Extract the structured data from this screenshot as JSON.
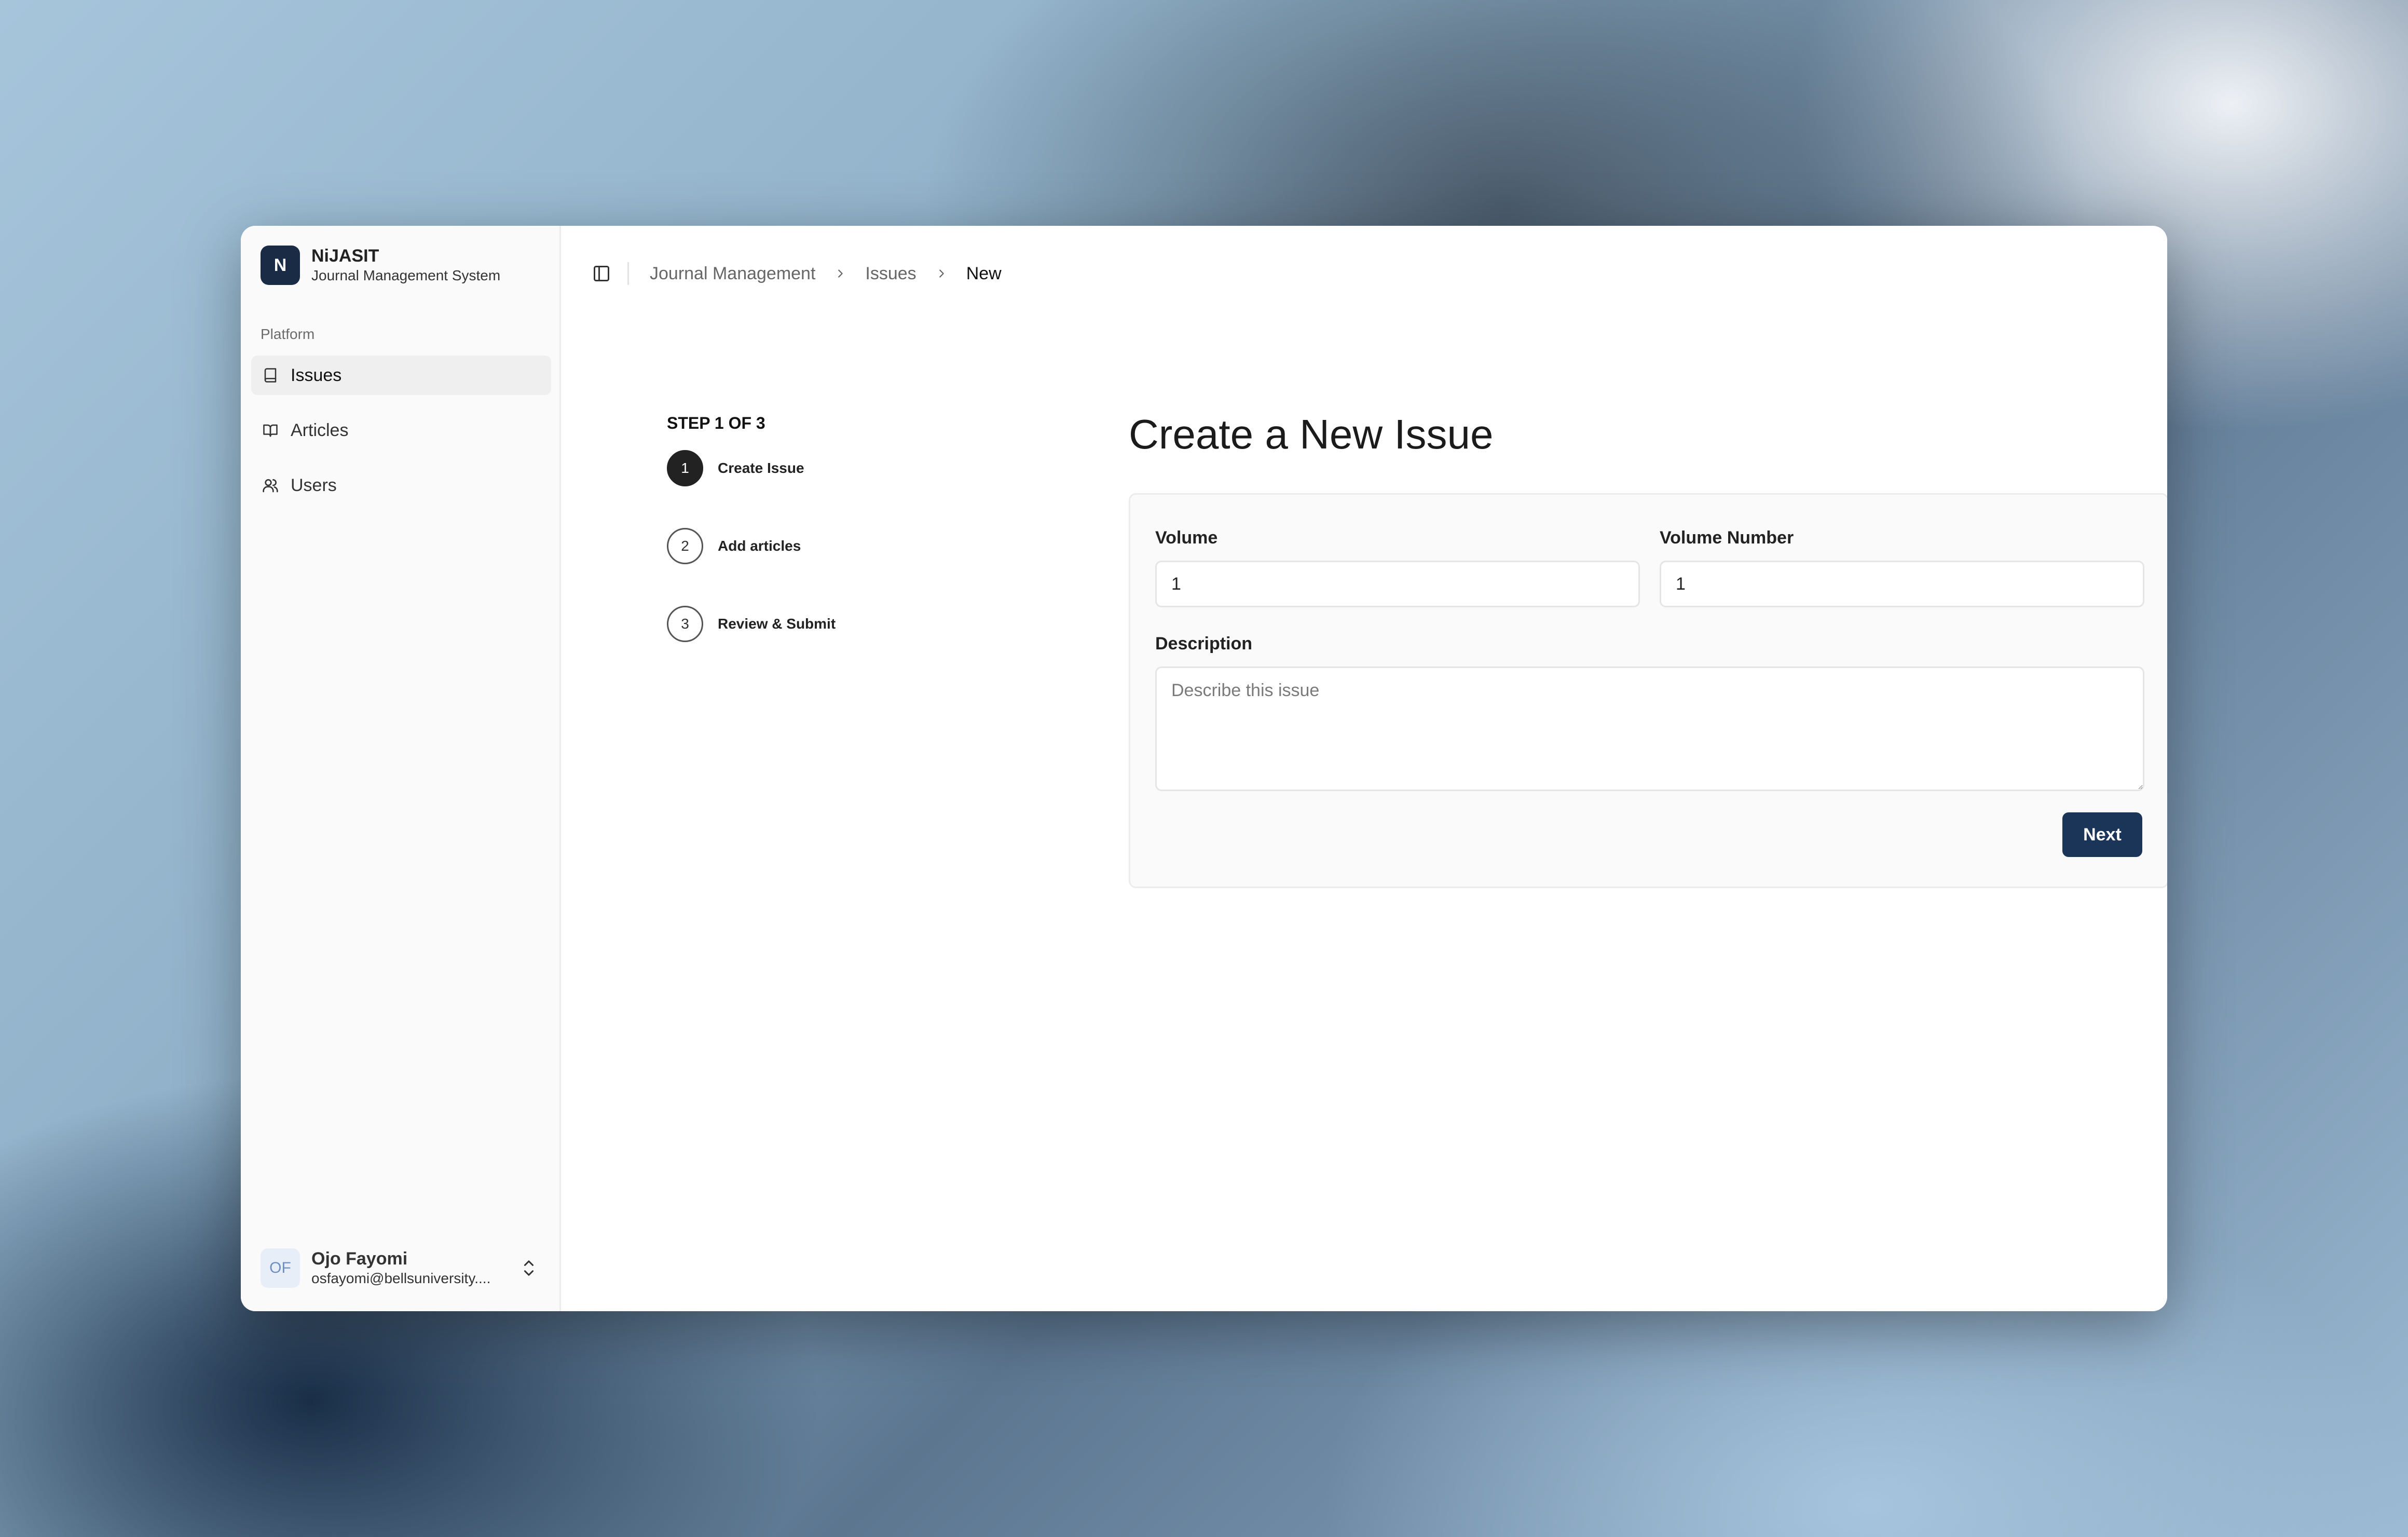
{
  "app": {
    "name": "NiJASIT",
    "subtitle": "Journal Management System",
    "logo_letter": "N"
  },
  "sidebar": {
    "section_label": "Platform",
    "items": [
      {
        "label": "Issues",
        "icon": "book-icon",
        "active": true
      },
      {
        "label": "Articles",
        "icon": "open-book-icon",
        "active": false
      },
      {
        "label": "Users",
        "icon": "users-icon",
        "active": false
      }
    ],
    "user": {
      "initials": "OF",
      "name": "Ojo Fayomi",
      "email": "osfayomi@bellsuniversity...."
    }
  },
  "breadcrumb": [
    "Journal Management",
    "Issues",
    "New"
  ],
  "wizard": {
    "step_indicator": "STEP 1 OF 3",
    "steps": [
      {
        "number": "1",
        "label": "Create Issue",
        "active": true
      },
      {
        "number": "2",
        "label": "Add articles",
        "active": false
      },
      {
        "number": "3",
        "label": "Review & Submit",
        "active": false
      }
    ]
  },
  "form": {
    "title": "Create a New Issue",
    "volume_label": "Volume",
    "volume_value": "1",
    "volume_number_label": "Volume Number",
    "volume_number_value": "1",
    "description_label": "Description",
    "description_placeholder": "Describe this issue",
    "next_label": "Next"
  },
  "colors": {
    "brand": "#1a2b45",
    "primary_button": "#1a3558",
    "active_step": "#222222"
  }
}
